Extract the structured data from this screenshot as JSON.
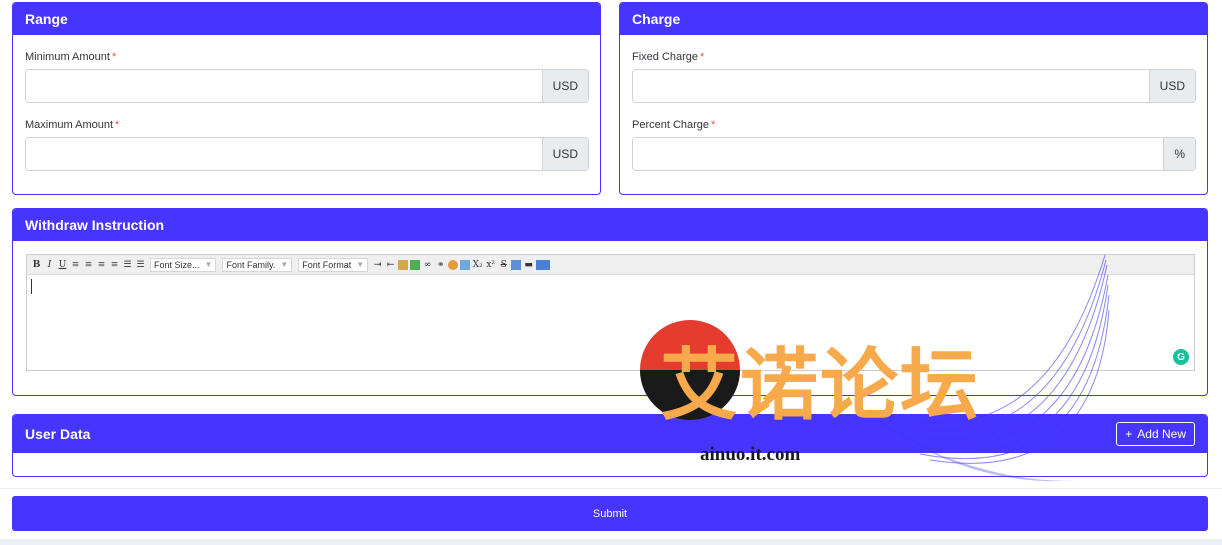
{
  "range": {
    "title": "Range",
    "min_label": "Minimum Amount",
    "min_value": "",
    "min_addon": "USD",
    "max_label": "Maximum Amount",
    "max_value": "",
    "max_addon": "USD",
    "required_mark": "*"
  },
  "charge": {
    "title": "Charge",
    "fixed_label": "Fixed Charge",
    "fixed_value": "",
    "fixed_addon": "USD",
    "percent_label": "Percent Charge",
    "percent_value": "",
    "percent_addon": "%",
    "required_mark": "*"
  },
  "withdraw": {
    "title": "Withdraw Instruction",
    "toolbar": {
      "bold": "B",
      "italic": "I",
      "underline": "U",
      "font_size": "Font Size...",
      "font_family": "Font Family.",
      "font_format": "Font Format",
      "subscript": "X₂",
      "superscript": "x²",
      "strike": "S"
    },
    "editor_value": ""
  },
  "user_data": {
    "title": "User Data",
    "add_new_label": "Add New",
    "add_new_icon": "plus-icon"
  },
  "submit_label": "Submit",
  "watermark": {
    "text": "艾诺论坛",
    "url": "ainuo.it.com"
  },
  "colors": {
    "primary": "#4634ff",
    "required": "#ea5455",
    "grammarly": "#15c39a"
  }
}
